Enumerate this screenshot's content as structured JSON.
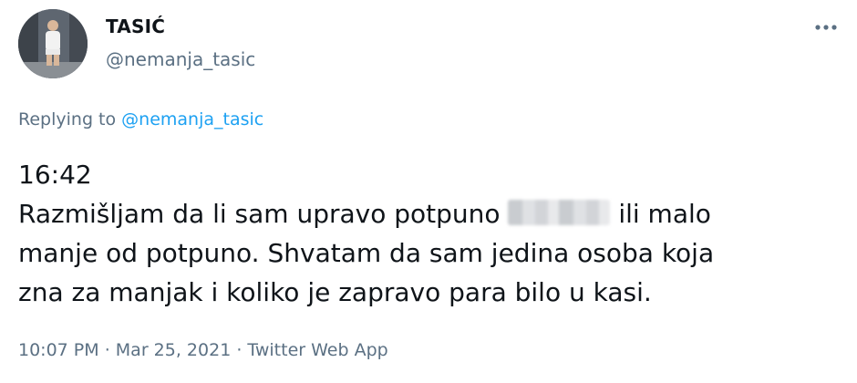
{
  "author": {
    "display_name": "TASIĆ",
    "handle": "@nemanja_tasic"
  },
  "reply": {
    "prefix": "Replying to ",
    "mention": "@nemanja_tasic"
  },
  "tweet": {
    "line1": "16:42",
    "line2_before": "Razmišljam da li sam upravo potpuno ",
    "line2_after": " ili malo",
    "line3": "manje od potpuno. Shvatam da sam jedina osoba koja",
    "line4": "zna za manjak i koliko je zapravo para bilo u kasi."
  },
  "meta": {
    "time": "10:07 PM",
    "separator1": " · ",
    "date": "Mar 25, 2021",
    "separator2": " · ",
    "source": "Twitter Web App"
  },
  "icons": {
    "more": "more-horizontal-icon",
    "avatar": "profile-photo"
  },
  "colors": {
    "link": "#1da1f2",
    "secondary_text": "#5b7083",
    "primary_text": "#0f1419"
  }
}
